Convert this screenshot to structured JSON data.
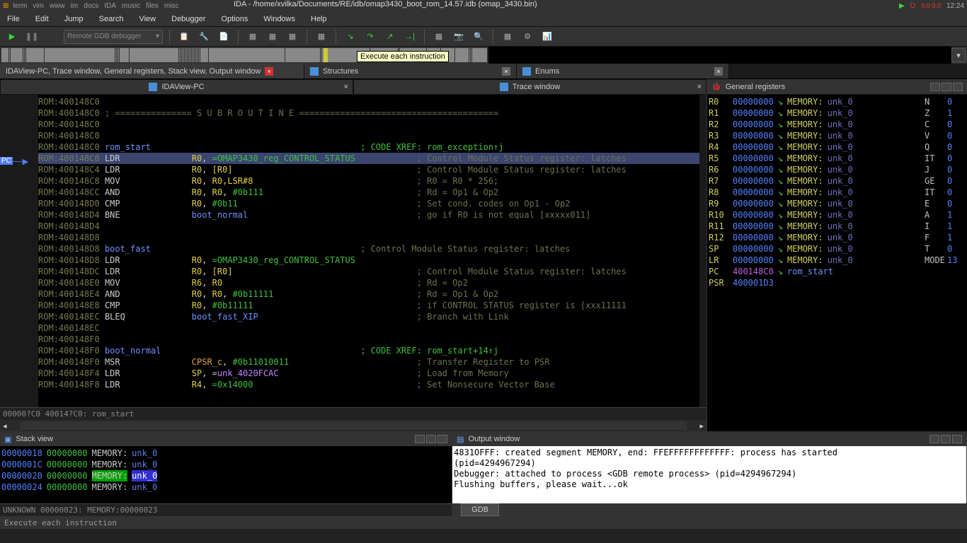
{
  "desktop": {
    "tasks": [
      "term",
      "vim",
      "www",
      "im",
      "docs",
      "IDA",
      "music",
      "files",
      "misc"
    ],
    "title": "IDA - /home/xvilka/Documents/RE/idb/omap3430_boot_rom_14.57.idb (omap_3430.bin)",
    "stats": "0.0 0.0",
    "clock": "12:24"
  },
  "menu": [
    "File",
    "Edit",
    "Jump",
    "Search",
    "View",
    "Debugger",
    "Options",
    "Windows",
    "Help"
  ],
  "debugger_combo": "Remote GDB debugger",
  "tooltip": "Execute each instruction",
  "tabs": {
    "main": "IDAView-PC, Trace window, General registers, Stack view, Output window",
    "structures": "Structures",
    "enums": "Enums"
  },
  "subtabs": {
    "ida": "IDAView-PC",
    "trace": "Trace window"
  },
  "regpanel": {
    "title": "General registers"
  },
  "disasm": {
    "lines": [
      {
        "a": "ROM:400148C0",
        "t": ""
      },
      {
        "a": "ROM:400148C0",
        "t": "; =============== S U B R O U T I N E =======================================",
        "sub": true
      },
      {
        "a": "ROM:400148C0",
        "t": ""
      },
      {
        "a": "ROM:400148C0",
        "t": ""
      },
      {
        "a": "ROM:400148C0",
        "lbl": "rom_start",
        "xref": "; CODE XREF: rom_exception↑j"
      },
      {
        "a": "ROM:400148C0",
        "m": "LDR",
        "ops": "R0, =OMAP3430_reg_CONTROL_STATUS",
        "c": "; Control Module Status register: latches",
        "hl": true
      },
      {
        "a": "ROM:400148C4",
        "m": "LDR",
        "ops": "R0, [R0]",
        "c": "; Control Module Status register: latches"
      },
      {
        "a": "ROM:400148C8",
        "m": "MOV",
        "ops": "R0, R0,LSR#8",
        "c": "; R0 = R0 * 256;"
      },
      {
        "a": "ROM:400148CC",
        "m": "AND",
        "ops": "R0, R0, #0b111",
        "c": "; Rd = Op1 & Op2"
      },
      {
        "a": "ROM:400148D0",
        "m": "CMP",
        "ops": "R0, #0b11",
        "c": "; Set cond. codes on Op1 - Op2"
      },
      {
        "a": "ROM:400148D4",
        "m": "BNE",
        "lbl2": "boot_normal",
        "c": "; go if R0 is not equal [xxxxx011]"
      },
      {
        "a": "ROM:400148D4",
        "t": ""
      },
      {
        "a": "ROM:400148D8",
        "t": ""
      },
      {
        "a": "ROM:400148D8",
        "lbl": "boot_fast",
        "c": "; Control Module Status register: latches"
      },
      {
        "a": "ROM:400148D8",
        "m": "LDR",
        "ops": "R0, =OMAP3430_reg_CONTROL_STATUS"
      },
      {
        "a": "ROM:400148DC",
        "m": "LDR",
        "ops": "R0, [R0]",
        "c": "; Control Module Status register: latches"
      },
      {
        "a": "ROM:400148E0",
        "m": "MOV",
        "ops": "R6, R0",
        "c": "; Rd = Op2"
      },
      {
        "a": "ROM:400148E4",
        "m": "AND",
        "ops": "R0, R0, #0b11111",
        "c": "; Rd = Op1 & Op2"
      },
      {
        "a": "ROM:400148E8",
        "m": "CMP",
        "ops": "R0, #0b11111",
        "c": "; if CONTROL STATUS register is [xxx11111"
      },
      {
        "a": "ROM:400148EC",
        "m": "BLEQ",
        "lbl2": "boot_fast_XIP",
        "c": "; Branch with Link"
      },
      {
        "a": "ROM:400148EC",
        "t": ""
      },
      {
        "a": "ROM:400148F0",
        "t": ""
      },
      {
        "a": "ROM:400148F0",
        "lbl": "boot_normal",
        "xref": "; CODE XREF: rom_start+14↑j"
      },
      {
        "a": "ROM:400148F0",
        "m": "MSR",
        "ops2": "CPSR_c, #0b11010011",
        "c": "; Transfer Register to PSR"
      },
      {
        "a": "ROM:400148F4",
        "m": "LDR",
        "ops3": "SP, =unk_4020FCAC",
        "c": "; Load from Memory"
      },
      {
        "a": "ROM:400148F8",
        "m": "LDR",
        "ops4": "R4, =0x14000",
        "c": "; Set Nonsecure Vector Base"
      }
    ],
    "locbar": "00000?C0 40014?C0: rom_start"
  },
  "registers": {
    "rows": [
      {
        "n": "R0",
        "v": "00000000",
        "m": "MEMORY:",
        "u": "unk_0"
      },
      {
        "n": "R1",
        "v": "00000000",
        "m": "MEMORY:",
        "u": "unk_0"
      },
      {
        "n": "R2",
        "v": "00000000",
        "m": "MEMORY:",
        "u": "unk_0"
      },
      {
        "n": "R3",
        "v": "00000000",
        "m": "MEMORY:",
        "u": "unk_0"
      },
      {
        "n": "R4",
        "v": "00000000",
        "m": "MEMORY:",
        "u": "unk_0"
      },
      {
        "n": "R5",
        "v": "00000000",
        "m": "MEMORY:",
        "u": "unk_0"
      },
      {
        "n": "R6",
        "v": "00000000",
        "m": "MEMORY:",
        "u": "unk_0"
      },
      {
        "n": "R7",
        "v": "00000000",
        "m": "MEMORY:",
        "u": "unk_0"
      },
      {
        "n": "R8",
        "v": "00000000",
        "m": "MEMORY:",
        "u": "unk_0"
      },
      {
        "n": "R9",
        "v": "00000000",
        "m": "MEMORY:",
        "u": "unk_0"
      },
      {
        "n": "R10",
        "v": "00000000",
        "m": "MEMORY:",
        "u": "unk_0"
      },
      {
        "n": "R11",
        "v": "00000000",
        "m": "MEMORY:",
        "u": "unk_0"
      },
      {
        "n": "R12",
        "v": "00000000",
        "m": "MEMORY:",
        "u": "unk_0"
      },
      {
        "n": "SP",
        "v": "00000000",
        "m": "MEMORY:",
        "u": "unk_0"
      },
      {
        "n": "LR",
        "v": "00000000",
        "m": "MEMORY:",
        "u": "unk_0"
      },
      {
        "n": "PC",
        "v": "400148C0",
        "m": "",
        "u": "rom_start",
        "pc": true
      },
      {
        "n": "PSR",
        "v": "400001D3",
        "m": "",
        "u": ""
      }
    ],
    "flags": [
      {
        "n": "N",
        "v": "0"
      },
      {
        "n": "Z",
        "v": "1"
      },
      {
        "n": "C",
        "v": "0"
      },
      {
        "n": "V",
        "v": "0"
      },
      {
        "n": "Q",
        "v": "0"
      },
      {
        "n": "IT",
        "v": "0"
      },
      {
        "n": "J",
        "v": "0"
      },
      {
        "n": "GE",
        "v": "0"
      },
      {
        "n": "IT",
        "v": "0"
      },
      {
        "n": "E",
        "v": "0"
      },
      {
        "n": "A",
        "v": "1"
      },
      {
        "n": "I",
        "v": "1"
      },
      {
        "n": "F",
        "v": "1"
      },
      {
        "n": "T",
        "v": "0"
      },
      {
        "n": "MODE",
        "v": "13"
      }
    ]
  },
  "stack": {
    "title": "Stack view",
    "rows": [
      {
        "a": "00000018",
        "v": "00000000",
        "m": "MEMORY:",
        "u": "unk_0"
      },
      {
        "a": "0000001C",
        "v": "00000000",
        "m": "MEMORY:",
        "u": "unk_0"
      },
      {
        "a": "00000020",
        "v": "00000000",
        "m": "MEMORY:",
        "u": "unk_0",
        "hl": true
      },
      {
        "a": "00000024",
        "v": "00000000",
        "m": "MEMORY:",
        "u": "unk_0"
      }
    ],
    "status": "UNKNOWN 00000023: MEMORY:00000023"
  },
  "output": {
    "title": "Output window",
    "lines": [
      "4831OFFF: created segment MEMORY, end: FFEFFFFFFFFFFFF: process  has started",
      "(pid=4294967294)",
      "Debugger: attached to process <GDB remote process> (pid=4294967294)",
      "Flushing buffers, please wait...ok"
    ],
    "gdb": "GDB"
  },
  "statusbar": "Execute each instruction"
}
